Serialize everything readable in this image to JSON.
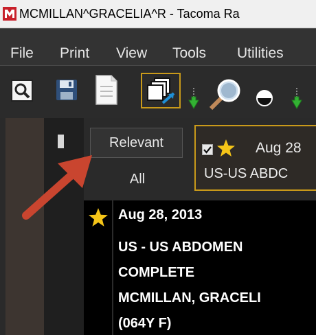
{
  "window": {
    "title": "MCMILLAN^GRACELIA^R - Tacoma Ra"
  },
  "menu": {
    "items": [
      "File",
      "Print",
      "View",
      "Tools",
      "Utilities"
    ]
  },
  "toolbar": {
    "buttons": [
      "search-study-icon",
      "save-disk-icon",
      "document-page-icon",
      "stacked-images-icon",
      "green-down-arrow-icon",
      "magnifier-icon",
      "half-circle-icon",
      "green-down-arrow-icon"
    ],
    "active_button": "stacked-images-icon"
  },
  "filters": {
    "relevant_label": "Relevant",
    "all_label": "All"
  },
  "study_chip": {
    "checked": true,
    "date": "Aug 28",
    "description": "US-US ABDC"
  },
  "study_list": [
    {
      "date": "Aug 28, 2013",
      "description_line1": "US - US ABDOMEN",
      "description_line2": "COMPLETE",
      "patient": "MCMILLAN, GRACELI",
      "age_sex": "(064Y F)"
    }
  ],
  "colors": {
    "accent_gold": "#c99a1a",
    "star_gold": "#f5c518",
    "annotation_arrow": "#c9452f",
    "menubar": "#333333"
  }
}
